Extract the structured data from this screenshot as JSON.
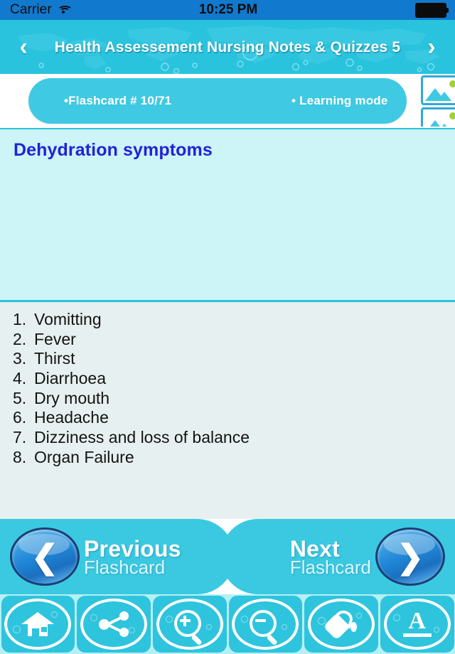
{
  "status_bar": {
    "carrier": "Carrier",
    "time": "10:25 PM",
    "wifi_icon": "wifi-icon",
    "battery_icon": "battery-icon"
  },
  "header": {
    "title": "Health Assessement Nursing Notes & Quizzes 5",
    "prev_arrow": "‹",
    "next_arrow": "›",
    "background_color": "#2ac3de"
  },
  "info_bar": {
    "flashcard_counter": "•Flashcard #  10/71",
    "mode": "• Learning mode",
    "pill_color": "#3fc9e2",
    "thumbnail_icon": "picture-icon"
  },
  "question": {
    "text": "Dehydration symptoms",
    "text_color": "#2222d8",
    "background_color": "#cdf4f7"
  },
  "answer": {
    "background_color": "#e7f0f0",
    "items": [
      {
        "num": "1.",
        "text": "Vomitting"
      },
      {
        "num": "2.",
        "text": "Fever"
      },
      {
        "num": "3.",
        "text": "Thirst"
      },
      {
        "num": "4.",
        "text": "Diarrhoea"
      },
      {
        "num": "5.",
        "text": "Dry mouth"
      },
      {
        "num": "6.",
        "text": "Headache"
      },
      {
        "num": "7.",
        "text": "Dizziness and loss of balance"
      },
      {
        "num": "8.",
        "text": "Organ Failure"
      }
    ]
  },
  "nav": {
    "previous": {
      "line1": "Previous",
      "line2": "Flashcard",
      "icon": "chevron-left-icon",
      "glyph": "❮"
    },
    "next": {
      "line1": "Next",
      "line2": "Flashcard",
      "icon": "chevron-right-icon",
      "glyph": "❯"
    },
    "band_color": "#3bc9e2"
  },
  "toolbar": {
    "background_color": "#b4f0f4",
    "button_color": "#2ec4dd",
    "buttons": [
      {
        "name": "home-button",
        "icon": "home-icon"
      },
      {
        "name": "share-button",
        "icon": "share-icon"
      },
      {
        "name": "zoom-in-button",
        "icon": "magnifier-plus-icon"
      },
      {
        "name": "zoom-out-button",
        "icon": "magnifier-minus-icon"
      },
      {
        "name": "background-color-button",
        "icon": "paint-bucket-icon"
      },
      {
        "name": "font-button",
        "icon": "font-letter-a-icon",
        "letter": "A"
      }
    ]
  }
}
